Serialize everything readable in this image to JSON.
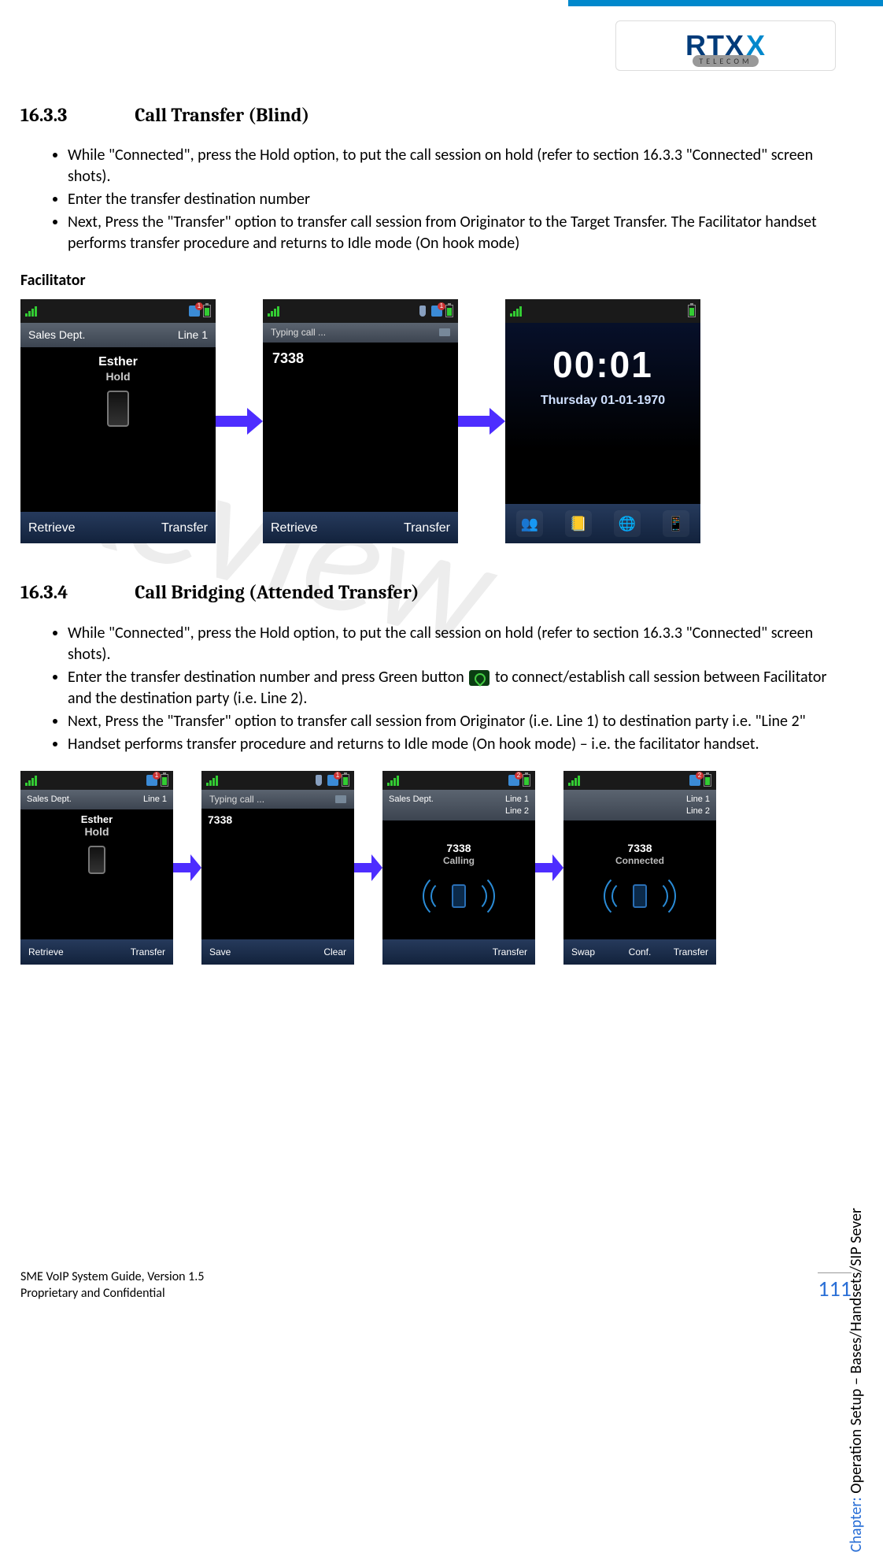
{
  "logo": {
    "main": "RTX",
    "x": "X",
    "sub": "TELECOM"
  },
  "section1": {
    "number": "16.3.3",
    "title": "Call Transfer (Blind)",
    "bullets": [
      "While \"Connected\", press the Hold option, to put the call session on hold (refer to section 16.3.3 \"Connected\" screen shots).",
      "Enter the transfer destination number",
      "Next, Press the \"Transfer\" option to transfer call session from Originator to the Target Transfer. The Facilitator handset performs transfer procedure and returns to Idle mode (On hook mode)"
    ],
    "facilitator_label": "Facilitator"
  },
  "screens1": {
    "a": {
      "dept": "Sales Dept.",
      "line": "Line 1",
      "name": "Esther",
      "state": "Hold",
      "sk_left": "Retrieve",
      "sk_right": "Transfer"
    },
    "b": {
      "typing": "Typing call ...",
      "number": "7338",
      "sk_left": "Retrieve",
      "sk_right": "Transfer"
    },
    "c": {
      "clock": "00:01",
      "date": "Thursday 01-01-1970"
    }
  },
  "section2": {
    "number": "16.3.4",
    "title": "Call Bridging (Attended Transfer)",
    "bullet1": "While \"Connected\", press the Hold option, to put the call session on hold (refer to section 16.3.3 \"Connected\" screen shots).",
    "bullet2a": "Enter the transfer destination number and press Green button ",
    "bullet2b": " to connect/establish call session between Facilitator and the destination party (i.e. Line 2).",
    "bullet3": "Next, Press the \"Transfer\" option to transfer call session from Originator (i.e. Line 1) to destination party i.e. \"Line 2\"",
    "bullet4": "Handset performs transfer procedure and returns to Idle mode (On hook mode) – i.e. the facilitator handset."
  },
  "screens2": {
    "a": {
      "dept": "Sales Dept.",
      "line": "Line 1",
      "name": "Esther",
      "state": "Hold",
      "sk_left": "Retrieve",
      "sk_right": "Transfer"
    },
    "b": {
      "typing": "Typing call ...",
      "number": "7338",
      "sk_left": "Save",
      "sk_right": "Clear"
    },
    "c": {
      "dept": "Sales Dept.",
      "line1": "Line 1",
      "line2": "Line 2",
      "num": "7338",
      "state": "Calling",
      "sk_right": "Transfer"
    },
    "d": {
      "line1": "Line 1",
      "line2": "Line 2",
      "num": "7338",
      "state": "Connected",
      "sk_left": "Swap",
      "sk_mid": "Conf.",
      "sk_right": "Transfer"
    }
  },
  "watermark": "Review",
  "side": {
    "label": "Chapter:",
    "text": " Operation Setup – Bases/Handsets/SIP Sever"
  },
  "footer": {
    "line1": "SME VoIP System Guide, Version 1.5",
    "line2": "Proprietary and Confidential",
    "page": "111"
  }
}
